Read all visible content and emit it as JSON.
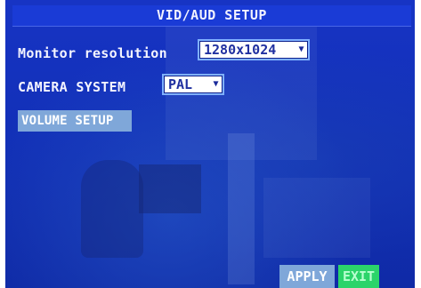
{
  "dialog": {
    "title": "VID/AUD SETUP"
  },
  "settings": {
    "monitor_resolution": {
      "label": "Monitor resolution",
      "value": "1280x1024"
    },
    "camera_system": {
      "label": "CAMERA SYSTEM",
      "value": "PAL"
    },
    "volume_setup_label": "VOLUME SETUP"
  },
  "footer": {
    "apply_label": "APPLY",
    "exit_label": "EXIT"
  },
  "colors": {
    "background_blue": "#1230b8",
    "selection_highlight": "#7fa7d9",
    "exit_green": "#2bd46a"
  }
}
